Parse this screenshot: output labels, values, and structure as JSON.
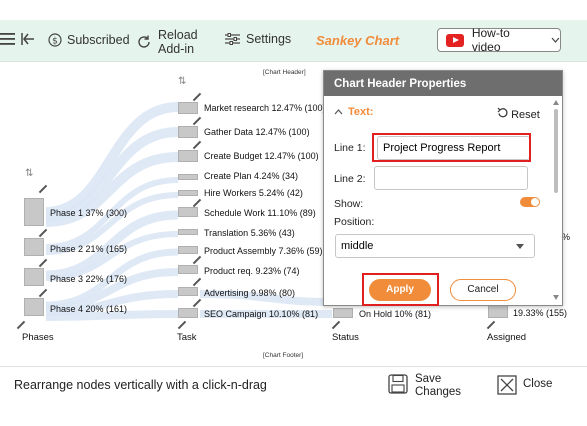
{
  "toolbar": {
    "subscribed_label": "Subscribed",
    "reload_line1": "Reload",
    "reload_line2": "Add-in",
    "settings_label": "Settings",
    "app_title": "Sankey Chart",
    "howto_label": "How-to video"
  },
  "chart": {
    "header_caption": "[Chart Header]",
    "footer_caption": "[Chart Footer]",
    "columns": [
      "Phases",
      "Task",
      "Status",
      "Assigned"
    ],
    "phases": [
      "Phase 1 37% (300)",
      "Phase 2 21% (165)",
      "Phase 3 22% (176)",
      "Phase 4 20% (161)"
    ],
    "tasks": [
      "Market research 12.47% (100)",
      "Gather Data 12.47% (100)",
      "Create Budget 12.47% (100)",
      "Create Plan 4.24% (34)",
      "Hire Workers 5.24% (42)",
      "Schedule Work 11.10% (89)",
      "Translation 5.36% (43)",
      "Product Assembly 7.36% (59)",
      "Product req. 9.23% (74)",
      "Advertising 9.98% (80)",
      "SEO Campaign 10.10% (81)"
    ],
    "status_visible": "On Hold 10% (81)",
    "assigned_visible": "19.33% (155)",
    "assigned_partial": "%"
  },
  "dialog": {
    "title": "Chart Header Properties",
    "section": "Text:",
    "reset_label": "Reset",
    "line1_label": "Line 1:",
    "line1_value": "Project Progress Report",
    "line2_label": "Line 2:",
    "line2_value": "",
    "show_label": "Show:",
    "position_label": "Position:",
    "position_value": "middle",
    "apply_label": "Apply",
    "cancel_label": "Cancel"
  },
  "bottom": {
    "hint": "Rearrange nodes vertically with a click-n-drag",
    "save_line1": "Save",
    "save_line2": "Changes",
    "close_label": "Close"
  },
  "colors": {
    "accent": "#f08c3a",
    "toolbar_bg": "#e6f4ee",
    "highlight": "#e0201e"
  }
}
